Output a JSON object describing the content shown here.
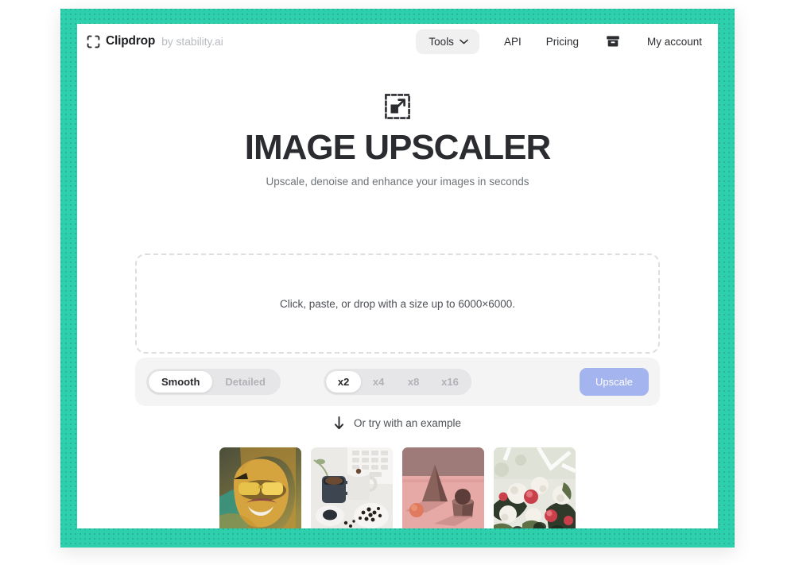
{
  "theme": {
    "frame_color": "#2ecfad",
    "page_bg": "#ffffff",
    "accent_button": "#a4b4ee",
    "text_primary": "#2a2c30",
    "text_muted": "#6e7378"
  },
  "header": {
    "logo_icon": "clipdrop-brackets-icon",
    "brand_name": "Clipdrop",
    "brand_suffix": "by stability.ai",
    "nav": {
      "tools": {
        "label": "Tools",
        "icon": "chevron-down-icon"
      },
      "api_label": "API",
      "pricing_label": "Pricing",
      "archive_icon": "archive-box-icon",
      "account_label": "My account"
    }
  },
  "hero": {
    "icon": "expand-upscale-icon",
    "title": "IMAGE UPSCALER",
    "subtitle": "Upscale, denoise and enhance your images in seconds"
  },
  "uploader": {
    "dropzone_text": "Click, paste, or drop with a size up to 6000×6000.",
    "mode_options": [
      {
        "label": "Smooth",
        "selected": true
      },
      {
        "label": "Detailed",
        "selected": false
      }
    ],
    "scale_options": [
      {
        "label": "x2",
        "selected": true
      },
      {
        "label": "x4",
        "selected": false
      },
      {
        "label": "x8",
        "selected": false
      },
      {
        "label": "x16",
        "selected": false
      }
    ],
    "submit_label": "Upscale"
  },
  "examples": {
    "icon": "arrow-down-icon",
    "label": "Or try with an example",
    "items": [
      {
        "name": "woman-with-sunglasses-photo",
        "alt": "Smiling woman wearing gold sunglasses"
      },
      {
        "name": "coffee-flatlay-photo",
        "alt": "Coffee cups and pastries flat lay"
      },
      {
        "name": "pink-still-life-photo",
        "alt": "Pink geometric still life with cone"
      },
      {
        "name": "flower-bouquet-photo",
        "alt": "White and red flower bouquet"
      }
    ]
  }
}
